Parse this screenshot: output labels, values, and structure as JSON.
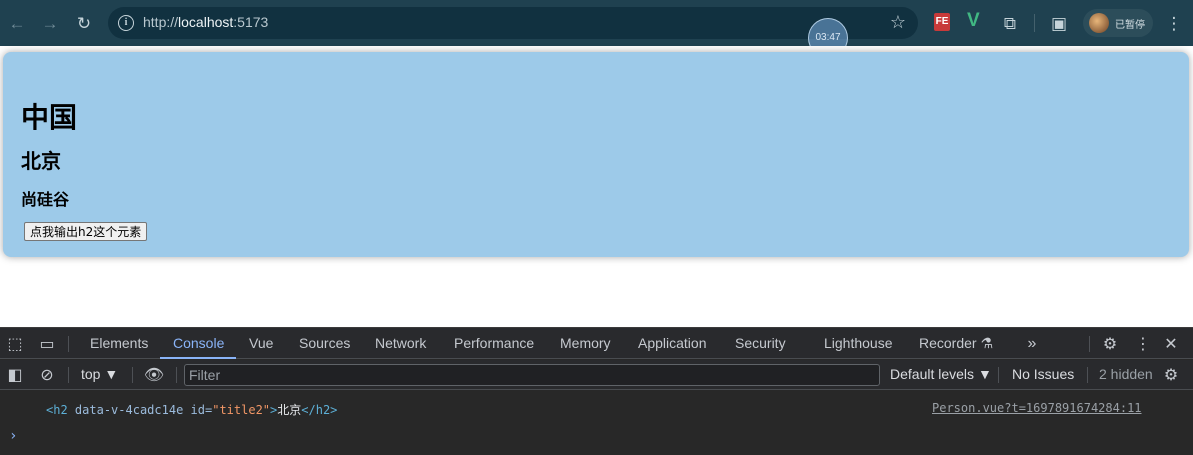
{
  "browser": {
    "url_prefix": "http://",
    "url_host": "localhost",
    "url_port": ":5173",
    "timer": "03:47",
    "extension_fe": "FE",
    "extension_vue": "V",
    "profile_status": "已暂停",
    "icons": [
      "back-arrow-icon",
      "forward-arrow-icon",
      "reload-icon",
      "info-icon",
      "star-icon",
      "extensions-puzzle-icon",
      "side-panel-icon",
      "kebab-menu-icon"
    ]
  },
  "page": {
    "h1": "中国",
    "h2": "北京",
    "h3": "尚硅谷",
    "button_label": "点我输出h2这个元素",
    "card_color": "#9dcae9"
  },
  "devtools": {
    "tabs": [
      "Elements",
      "Console",
      "Vue",
      "Sources",
      "Network",
      "Performance",
      "Memory",
      "Application",
      "Security",
      "Lighthouse",
      "Recorder"
    ],
    "active_tab": "Console",
    "context": "top",
    "filter_placeholder": "Filter",
    "levels": "Default levels",
    "issues": "No Issues",
    "hidden": "2 hidden",
    "log": {
      "open_tag": "<h2",
      "attr_scope": "data-v-4cadc14e",
      "attr_id_name": "id=",
      "attr_id_value": "\"title2\"",
      "gt": ">",
      "text": "北京",
      "close_tag": "</h2>",
      "source": "Person.vue?t=1697891674284:11"
    },
    "prompt": "›"
  }
}
